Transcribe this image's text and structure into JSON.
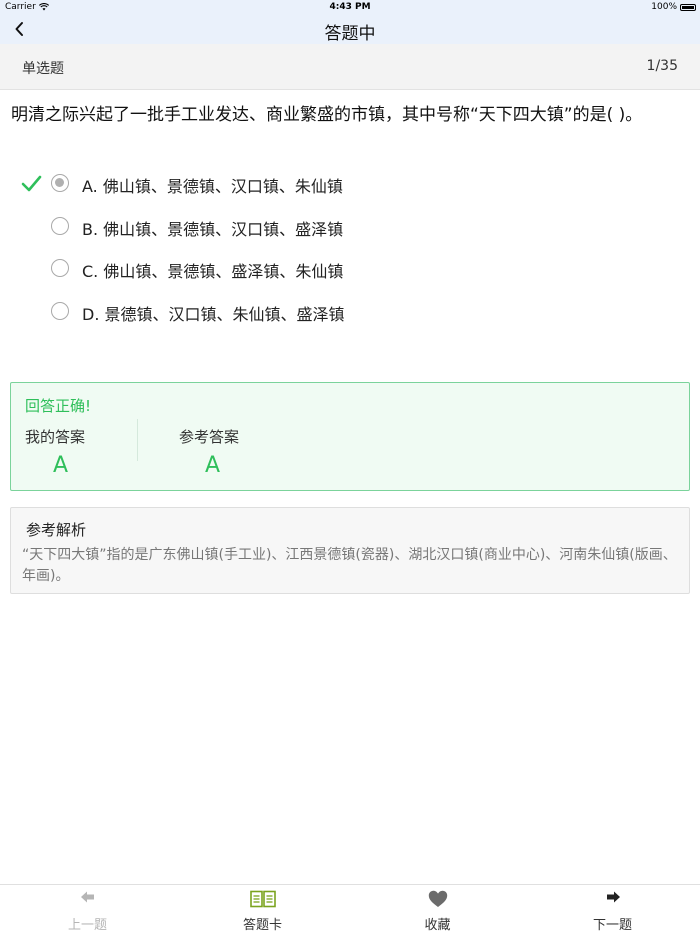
{
  "status_bar": {
    "carrier": "Carrier",
    "time": "4:43 PM",
    "battery": "100%"
  },
  "nav": {
    "title": "答题中"
  },
  "question_header": {
    "type": "单选题",
    "progress": "1/35"
  },
  "question": {
    "text": "明清之际兴起了一批手工业发达、商业繁盛的市镇，其中号称“天下四大镇”的是(   )。"
  },
  "options": [
    {
      "label": "A. 佛山镇、景德镇、汉口镇、朱仙镇",
      "selected": true,
      "correct": true
    },
    {
      "label": "B. 佛山镇、景德镇、汉口镇、盛泽镇",
      "selected": false,
      "correct": false
    },
    {
      "label": "C. 佛山镇、景德镇、盛泽镇、朱仙镇",
      "selected": false,
      "correct": false
    },
    {
      "label": "D. 景德镇、汉口镇、朱仙镇、盛泽镇",
      "selected": false,
      "correct": false
    }
  ],
  "result": {
    "status": "回答正确!",
    "my_answer_label": "我的答案",
    "my_answer": "A",
    "ref_answer_label": "参考答案",
    "ref_answer": "A"
  },
  "analysis": {
    "title": "参考解析",
    "text": "“天下四大镇”指的是广东佛山镇(手工业)、江西景德镇(瓷器)、湖北汉口镇(商业中心)、河南朱仙镇(版画、年画)。"
  },
  "tabs": {
    "prev": "上一题",
    "card": "答题卡",
    "favorite": "收藏",
    "next": "下一题"
  },
  "colors": {
    "accent_green": "#2fbf5b",
    "card_icon": "#7ba31e",
    "nav_bg": "#eaf1fb"
  },
  "icons": {
    "back": "chevron-left-icon",
    "correct": "checkmark-icon",
    "prev": "arrow-left-icon",
    "card": "book-icon",
    "favorite": "heart-icon",
    "next": "arrow-right-icon"
  }
}
